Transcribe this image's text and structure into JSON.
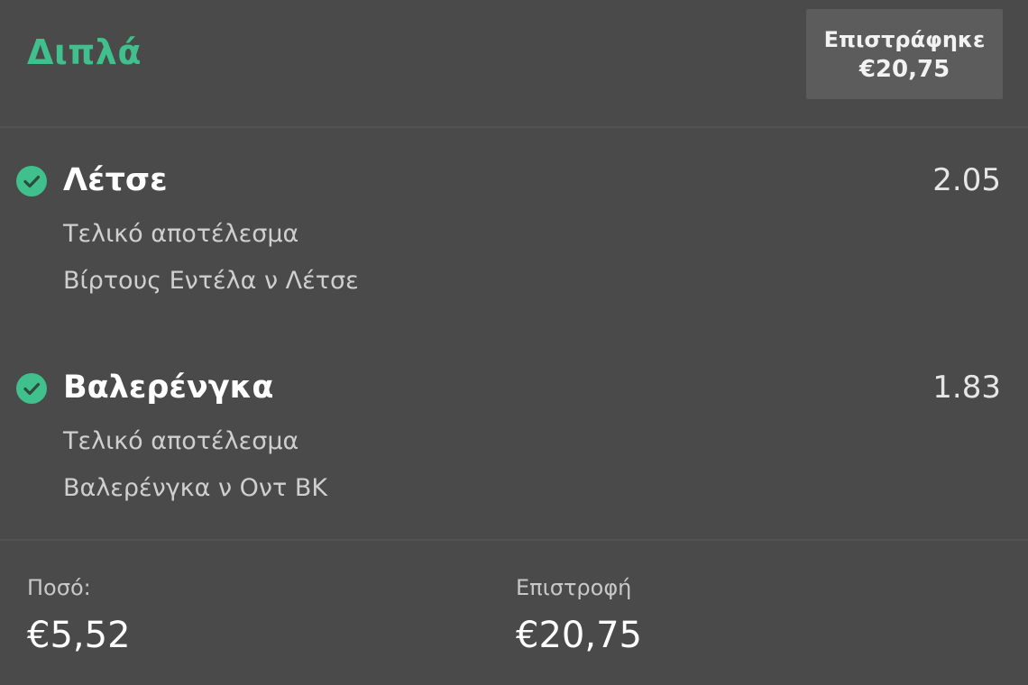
{
  "header": {
    "bet_type": "Διπλά",
    "returned_label": "Επιστράφηκε",
    "returned_amount": "€20,75"
  },
  "selections": [
    {
      "name": "Λέτσε",
      "odds": "2.05",
      "market": "Τελικό αποτέλεσμα",
      "event": "Βίρτους Εντέλα ν Λέτσε",
      "status_icon": "check-circle-icon"
    },
    {
      "name": "Βαλερένγκα",
      "odds": "1.83",
      "market": "Τελικό αποτέλεσμα",
      "event": "Βαλερένγκα ν Οντ ΒΚ",
      "status_icon": "check-circle-icon"
    }
  ],
  "footer": {
    "stake_label": "Ποσό:",
    "stake_value": "€5,52",
    "return_label": "Επιστροφή",
    "return_value": "€20,75"
  },
  "colors": {
    "background": "#4a4a4a",
    "accent_green": "#3fc08c",
    "badge_bg": "#5c5c5c"
  }
}
